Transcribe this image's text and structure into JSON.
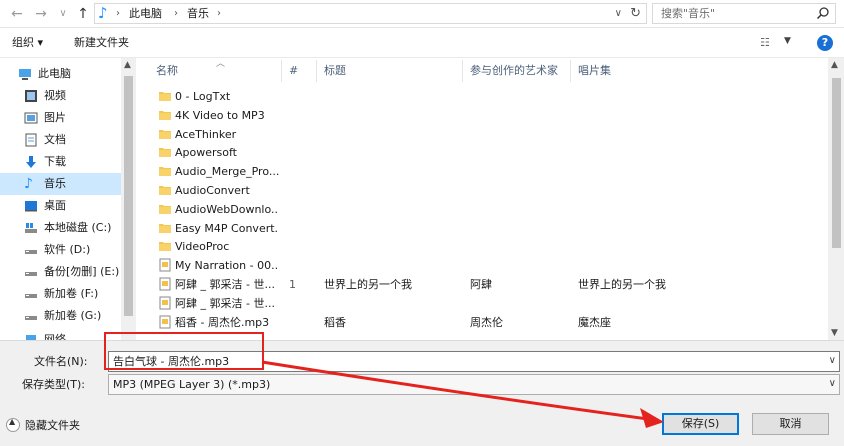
{
  "address": {
    "back": "←",
    "forward": "→",
    "recent": "∨",
    "up": "↑",
    "path": [
      "此电脑",
      "音乐"
    ],
    "search_placeholder": "搜索\"音乐\""
  },
  "toolbar": {
    "organize": "组织 ▾",
    "new_folder": "新建文件夹"
  },
  "nav": {
    "items": [
      {
        "label": "此电脑",
        "icon": "computer-icon"
      },
      {
        "label": "视频",
        "icon": "video-icon"
      },
      {
        "label": "图片",
        "icon": "picture-icon"
      },
      {
        "label": "文档",
        "icon": "document-icon"
      },
      {
        "label": "下载",
        "icon": "download-icon"
      },
      {
        "label": "音乐",
        "icon": "music-icon",
        "selected": true
      },
      {
        "label": "桌面",
        "icon": "desktop-icon"
      },
      {
        "label": "本地磁盘 (C:)",
        "icon": "windows-drive-icon"
      },
      {
        "label": "软件 (D:)",
        "icon": "drive-icon"
      },
      {
        "label": "备份[勿删] (E:)",
        "icon": "drive-icon"
      },
      {
        "label": "新加卷 (F:)",
        "icon": "drive-icon"
      },
      {
        "label": "新加卷 (G:)",
        "icon": "drive-icon"
      },
      {
        "label": "网络",
        "icon": "network-icon"
      }
    ]
  },
  "columns": {
    "name": "名称",
    "num": "#",
    "title": "标题",
    "artist": "参与创作的艺术家",
    "album": "唱片集"
  },
  "files": [
    {
      "name": "0 - LogTxt",
      "type": "folder",
      "num": "",
      "title": "",
      "artist": "",
      "album": ""
    },
    {
      "name": "4K Video to MP3",
      "type": "folder",
      "num": "",
      "title": "",
      "artist": "",
      "album": ""
    },
    {
      "name": "AceThinker",
      "type": "folder",
      "num": "",
      "title": "",
      "artist": "",
      "album": ""
    },
    {
      "name": "Apowersoft",
      "type": "folder",
      "num": "",
      "title": "",
      "artist": "",
      "album": ""
    },
    {
      "name": "Audio_Merge_Pro...",
      "type": "folder",
      "num": "",
      "title": "",
      "artist": "",
      "album": ""
    },
    {
      "name": "AudioConvert",
      "type": "folder",
      "num": "",
      "title": "",
      "artist": "",
      "album": ""
    },
    {
      "name": "AudioWebDownlo...",
      "type": "folder",
      "num": "",
      "title": "",
      "artist": "",
      "album": ""
    },
    {
      "name": "Easy M4P Convert...",
      "type": "folder",
      "num": "",
      "title": "",
      "artist": "",
      "album": ""
    },
    {
      "name": "VideoProc",
      "type": "folder",
      "num": "",
      "title": "",
      "artist": "",
      "album": ""
    },
    {
      "name": "My Narration - 00...",
      "type": "file",
      "num": "",
      "title": "",
      "artist": "",
      "album": ""
    },
    {
      "name": "阿肆 _ 郭采洁 - 世...",
      "type": "file",
      "num": "1",
      "title": "世界上的另一个我",
      "artist": "阿肆",
      "album": "世界上的另一个我"
    },
    {
      "name": "阿肆 _ 郭采洁 - 世...",
      "type": "file",
      "num": "",
      "title": "",
      "artist": "",
      "album": ""
    },
    {
      "name": "稻香 - 周杰伦.mp3",
      "type": "file",
      "num": "",
      "title": "稻香",
      "artist": "周杰伦",
      "album": "魔杰座"
    }
  ],
  "bottom": {
    "filename_label": "文件名(N):",
    "filename_value": "告白气球 - 周杰伦.mp3",
    "type_label": "保存类型(T):",
    "type_value": "MP3 (MPEG Layer 3) (*.mp3)",
    "hide_folders": "隐藏文件夹",
    "save": "保存(S)",
    "cancel": "取消"
  },
  "colors": {
    "accent": "#0078d7",
    "selection": "#cce8ff",
    "annotation": "#e5231e",
    "folder": "#f3c851"
  }
}
